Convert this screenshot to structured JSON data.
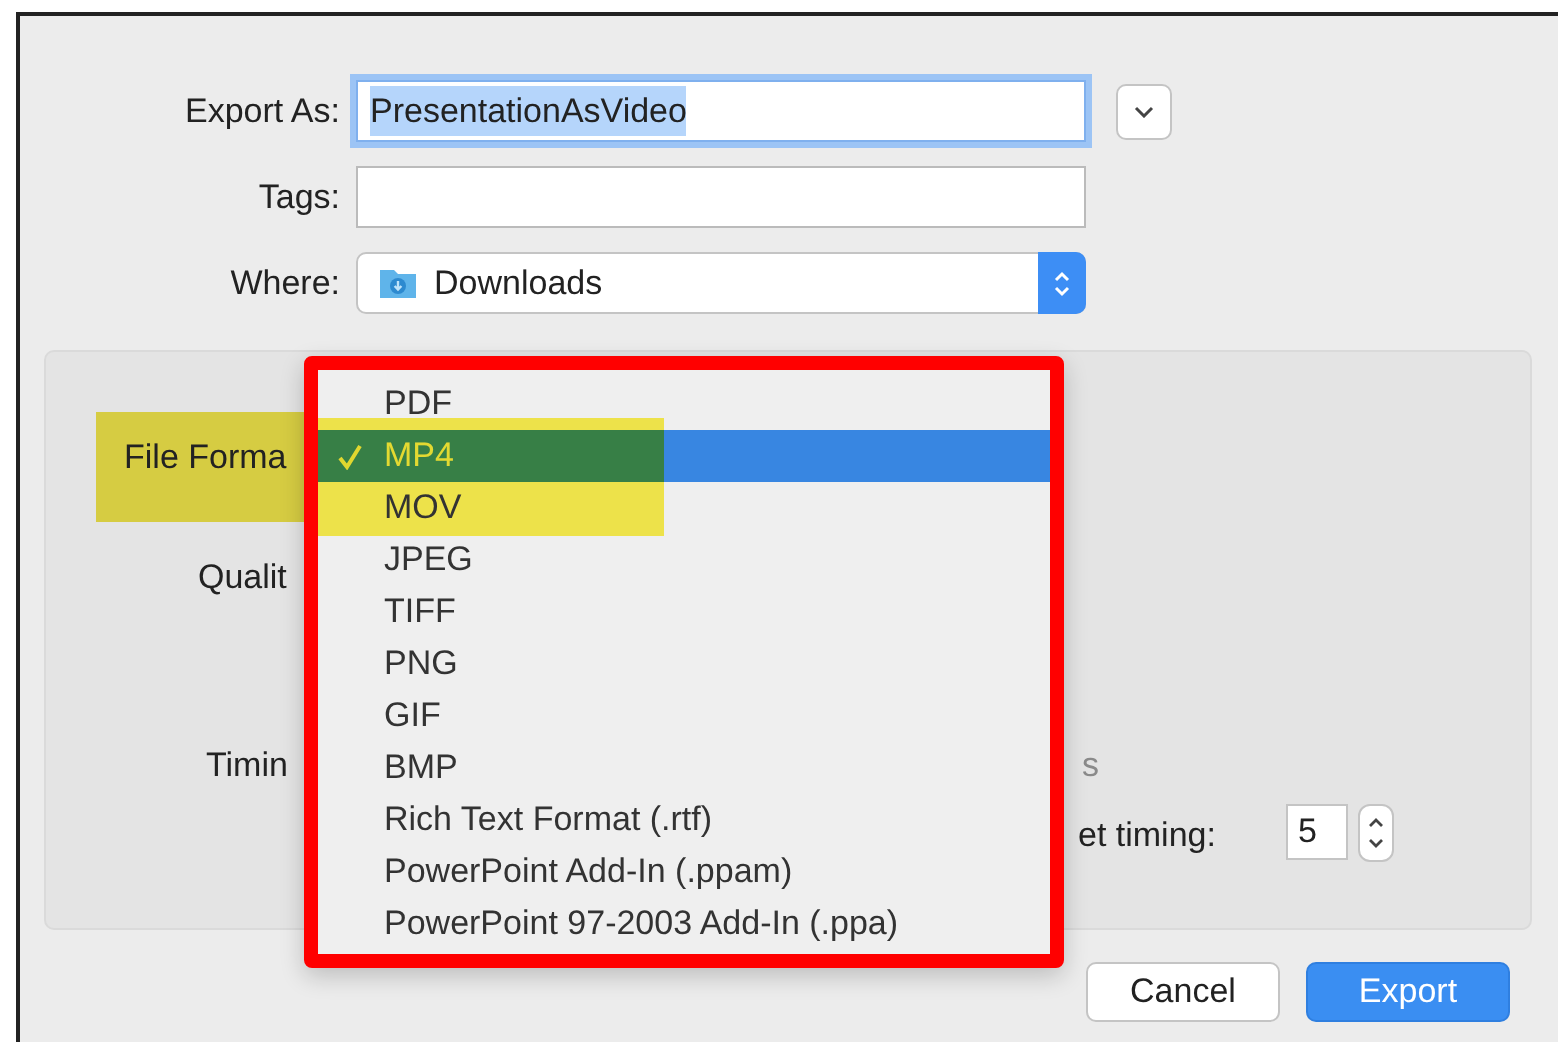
{
  "export_as": {
    "label": "Export As:",
    "value": "PresentationAsVideo"
  },
  "tags": {
    "label": "Tags:"
  },
  "where": {
    "label": "Where:",
    "value": "Downloads"
  },
  "options": {
    "file_format_label": "File Forma",
    "quality_label": "Qualit",
    "timing_label": "Timin",
    "faint_text": "s",
    "timing_field_label": "et timing:",
    "timing_value": "5"
  },
  "format_menu": {
    "items": [
      {
        "label": "PDF",
        "selected": false
      },
      {
        "label": "MP4",
        "selected": true
      },
      {
        "label": "MOV",
        "selected": false
      },
      {
        "label": "JPEG",
        "selected": false
      },
      {
        "label": "TIFF",
        "selected": false
      },
      {
        "label": "PNG",
        "selected": false
      },
      {
        "label": "GIF",
        "selected": false
      },
      {
        "label": "BMP",
        "selected": false
      },
      {
        "label": "Rich Text Format (.rtf)",
        "selected": false
      },
      {
        "label": "PowerPoint Add-In (.ppam)",
        "selected": false
      },
      {
        "label": "PowerPoint 97-2003 Add-In (.ppa)",
        "selected": false
      }
    ]
  },
  "buttons": [
    {
      "label": "Cancel",
      "kind": "default"
    },
    {
      "label": "Export",
      "kind": "primary"
    }
  ]
}
